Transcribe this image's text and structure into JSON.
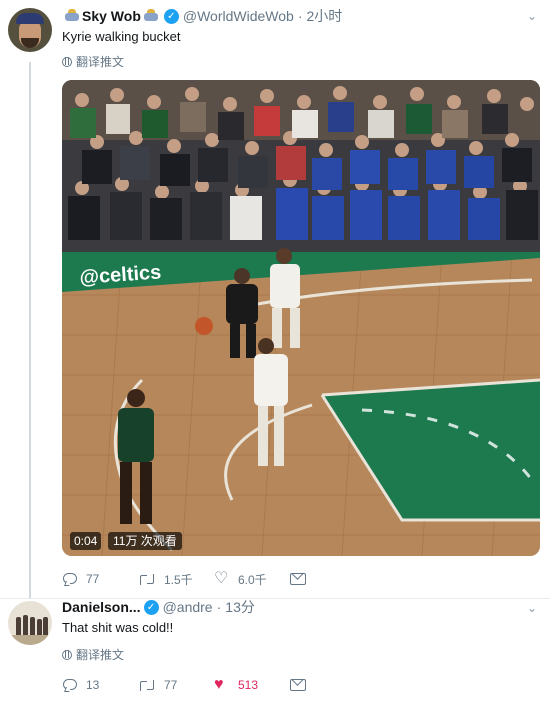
{
  "tweets": [
    {
      "display_name": "Sky Wob",
      "handle": "@WorldWideWob",
      "time": "2小时",
      "text": "Kyrie walking bucket",
      "translate_label": "翻译推文",
      "video": {
        "timestamp": "0:04",
        "views": "11万 次观看",
        "court_logo_text": "@celtics"
      },
      "actions": {
        "replies": "77",
        "retweets": "1.5千",
        "likes": "6.0千"
      }
    },
    {
      "display_name": "Danielson...",
      "handle": "@andre",
      "time": "13分",
      "text": "That shit was cold!!",
      "translate_label": "翻译推文",
      "actions": {
        "replies": "13",
        "retweets": "77",
        "likes": "513"
      }
    }
  ],
  "colors": {
    "accent": "#1da1f2",
    "like_active": "#e0245e",
    "muted": "#657786",
    "court_green": "#1d7a4f",
    "court_wood": "#b6875a"
  },
  "icons": {
    "verified": "verified-check-icon",
    "menu": "chevron-down-icon",
    "translate": "globe-icon",
    "reply": "reply-icon",
    "retweet": "retweet-icon",
    "like": "heart-icon",
    "message": "direct-message-icon"
  }
}
